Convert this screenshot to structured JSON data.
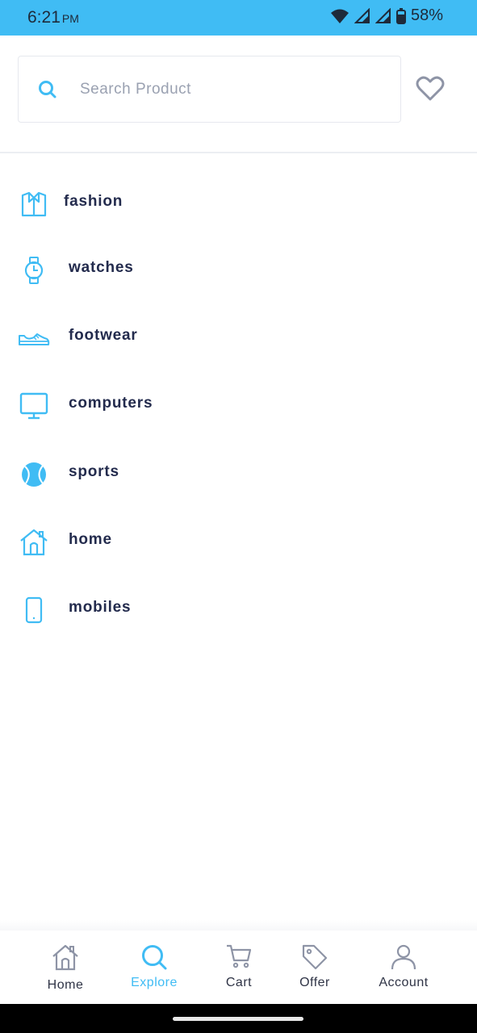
{
  "status_bar": {
    "time": "6:21",
    "ampm": "PM",
    "battery": "58%",
    "icons": [
      "wifi-icon",
      "signal-icon",
      "signal-icon",
      "battery-icon"
    ]
  },
  "search": {
    "placeholder": "Search Product",
    "value": "",
    "icon": "search-icon",
    "favorite_icon": "heart-icon"
  },
  "categories": [
    {
      "label": "fashion",
      "icon": "shirt-icon"
    },
    {
      "label": "watches",
      "icon": "watch-icon"
    },
    {
      "label": "footwear",
      "icon": "shoe-icon"
    },
    {
      "label": "computers",
      "icon": "monitor-icon"
    },
    {
      "label": "sports",
      "icon": "ball-icon"
    },
    {
      "label": "home",
      "icon": "house-icon"
    },
    {
      "label": "mobiles",
      "icon": "phone-icon"
    }
  ],
  "bottom_nav": {
    "active": "Explore",
    "items": [
      {
        "label": "Home",
        "icon": "home-icon"
      },
      {
        "label": "Explore",
        "icon": "search-icon"
      },
      {
        "label": "Cart",
        "icon": "cart-icon"
      },
      {
        "label": "Offer",
        "icon": "tag-icon"
      },
      {
        "label": "Account",
        "icon": "user-icon"
      }
    ]
  },
  "colors": {
    "accent": "#40bcf4",
    "text_dark": "#232b4d",
    "placeholder": "#9aa1b1"
  }
}
